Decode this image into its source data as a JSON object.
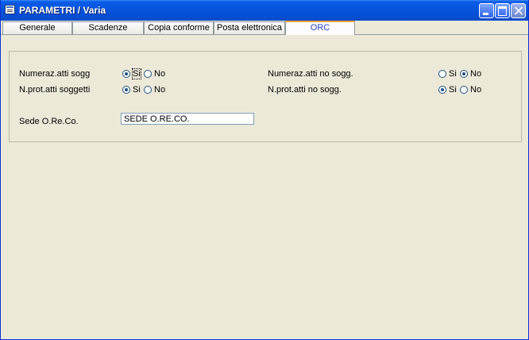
{
  "window": {
    "title": "PARAMETRI / Varia"
  },
  "tabs": [
    {
      "label": "Generale"
    },
    {
      "label": "Scadenze"
    },
    {
      "label": "Copia conforme"
    },
    {
      "label": "Posta elettronica"
    },
    {
      "label": "ORC",
      "active": true
    }
  ],
  "form": {
    "rows": [
      {
        "label": "Numeraz.atti sogg",
        "yes": "Si",
        "no": "No",
        "selected": "Si"
      },
      {
        "label": "N.prot.atti soggetti",
        "yes": "Si",
        "no": "No",
        "selected": "Si"
      },
      {
        "label": "Numeraz.atti no sogg.",
        "yes": "Si",
        "no": "No",
        "selected": "No"
      },
      {
        "label": "N.prot.atti no sogg.",
        "yes": "Si",
        "no": "No",
        "selected": "Si"
      }
    ],
    "sede": {
      "label": "Sede O.Re.Co.",
      "value": "SEDE O.RE.CO."
    }
  },
  "colors": {
    "titlebar": "#0855dd",
    "face": "#ece9d8",
    "active_tab_accent": "#f2a53c",
    "active_tab_text": "#2a44c4"
  }
}
